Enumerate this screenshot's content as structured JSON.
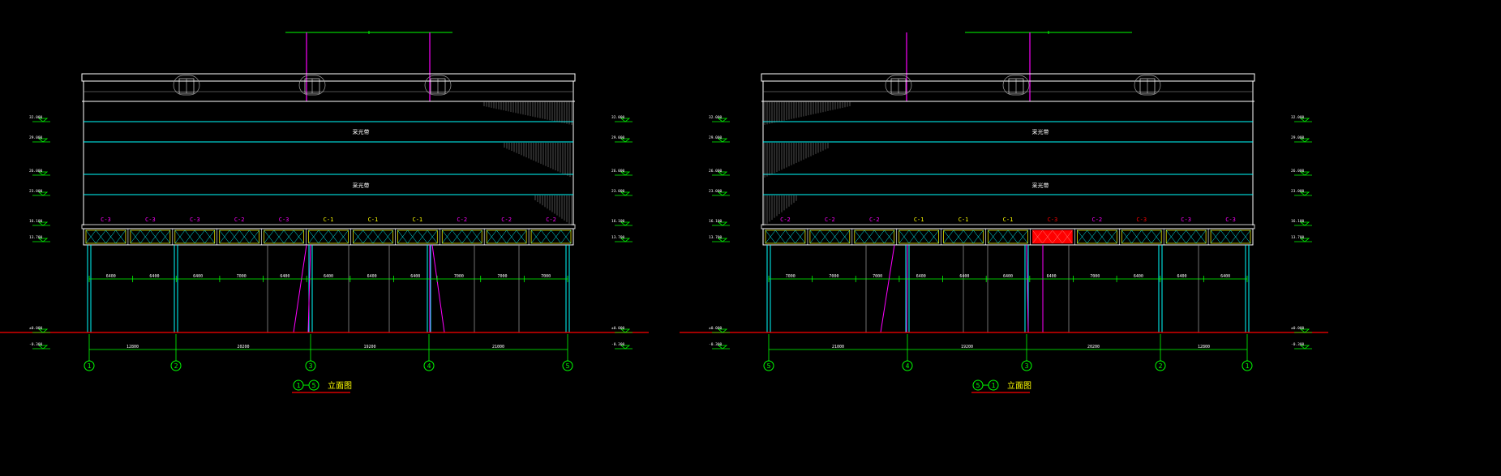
{
  "colors": {
    "background": "#000000",
    "outline": "#ffffff",
    "cyan": "#00ffff",
    "green": "#00ff00",
    "magenta": "#ff00ff",
    "yellow": "#ffff00",
    "red": "#ff0000",
    "gray": "#a0a0a0"
  },
  "elevations": [
    {
      "id": "front",
      "offsetX": 0,
      "caption": "立面图",
      "captionAxes": [
        "1",
        "5"
      ],
      "mid_band_label": "采光带",
      "lower_band_label": "采光带",
      "level_labels": [
        "32.000",
        "29.000",
        "26.000",
        "23.000",
        "16.100",
        "13.700",
        "±0.000",
        "-0.300"
      ],
      "window_tags": [
        {
          "text": "C-3",
          "color": "magenta"
        },
        {
          "text": "C-3",
          "color": "magenta"
        },
        {
          "text": "C-3",
          "color": "magenta"
        },
        {
          "text": "C-2",
          "color": "magenta"
        },
        {
          "text": "C-3",
          "color": "magenta"
        },
        {
          "text": "C-1",
          "color": "yellow"
        },
        {
          "text": "C-1",
          "color": "yellow"
        },
        {
          "text": "C-1",
          "color": "yellow"
        },
        {
          "text": "C-2",
          "color": "magenta"
        },
        {
          "text": "C-2",
          "color": "magenta"
        },
        {
          "text": "C-2",
          "color": "magenta"
        }
      ],
      "inner_dims": [
        "6400",
        "6400",
        "6400",
        "7000",
        "6400",
        "6400",
        "6400",
        "6400",
        "7000",
        "7000",
        "7000"
      ],
      "bay_dims": [
        "12800",
        "20200",
        "19200",
        "21000"
      ],
      "axes": [
        "1",
        "2",
        "3",
        "4",
        "5"
      ]
    },
    {
      "id": "rear",
      "offsetX": 838,
      "caption": "立面图",
      "captionAxes": [
        "5",
        "1"
      ],
      "mid_band_label": "采光带",
      "lower_band_label": "采光带",
      "level_labels": [
        "32.000",
        "29.000",
        "26.000",
        "23.000",
        "16.100",
        "13.700",
        "±0.000",
        "-0.300"
      ],
      "window_tags": [
        {
          "text": "C-2",
          "color": "magenta"
        },
        {
          "text": "C-2",
          "color": "magenta"
        },
        {
          "text": "C-2",
          "color": "magenta"
        },
        {
          "text": "C-1",
          "color": "yellow"
        },
        {
          "text": "C-1",
          "color": "yellow"
        },
        {
          "text": "C-1",
          "color": "yellow"
        },
        {
          "text": "C-3",
          "color": "red"
        },
        {
          "text": "C-2",
          "color": "magenta"
        },
        {
          "text": "C-3",
          "color": "red"
        },
        {
          "text": "C-3",
          "color": "magenta"
        },
        {
          "text": "C-3",
          "color": "magenta"
        }
      ],
      "inner_dims": [
        "7000",
        "7000",
        "7000",
        "6400",
        "6400",
        "6400",
        "6400",
        "7000",
        "6400",
        "6400",
        "6400"
      ],
      "bay_dims": [
        "21000",
        "19200",
        "20200",
        "12800"
      ],
      "axes": [
        "5",
        "4",
        "3",
        "2",
        "1"
      ]
    }
  ]
}
